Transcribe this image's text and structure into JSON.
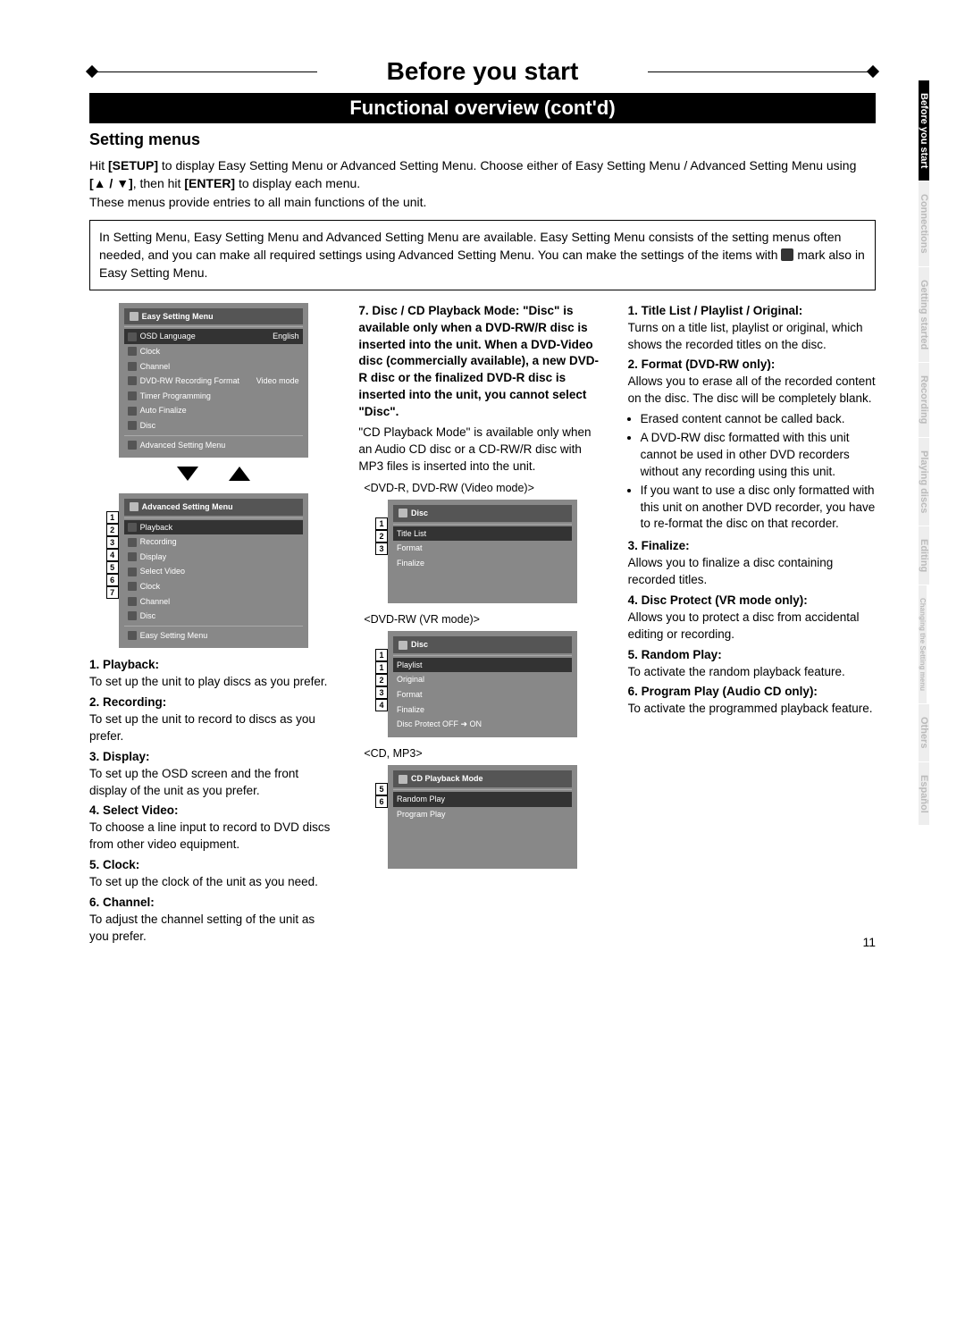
{
  "title": "Before you start",
  "subtitle": "Functional overview (cont'd)",
  "section_heading": "Setting menus",
  "intro": {
    "line1a": "Hit ",
    "button1": "[SETUP]",
    "line1b": " to display Easy Setting Menu or Advanced Setting Menu. Choose either of Easy Setting Menu / Advanced Setting Menu using ",
    "arrows": "[▲ / ▼]",
    "line1c": ", then hit ",
    "button2": "[ENTER]",
    "line1d": " to display each menu.",
    "line2": "These menus provide entries to all main functions of the unit."
  },
  "info_box": {
    "text_a": "In Setting Menu, Easy Setting Menu and Advanced Setting Menu are available. Easy Setting Menu consists of the setting menus often needed, and you can make all required settings using Advanced Setting Menu. You can make the settings of the items with ",
    "text_b": " mark also in Easy Setting Menu."
  },
  "easy_menu": {
    "header": "Easy Setting Menu",
    "rows": [
      {
        "label": "OSD Language",
        "value": "English",
        "hl": true
      },
      {
        "label": "Clock"
      },
      {
        "label": "Channel"
      },
      {
        "label": "DVD-RW Recording Format",
        "value": "Video mode"
      },
      {
        "label": "Timer Programming"
      },
      {
        "label": "Auto Finalize"
      },
      {
        "label": "Disc"
      }
    ],
    "footer": "Advanced Setting Menu"
  },
  "adv_menu": {
    "header": "Advanced Setting Menu",
    "rows": [
      {
        "num": "1",
        "label": "Playback",
        "hl": true
      },
      {
        "num": "2",
        "label": "Recording"
      },
      {
        "num": "3",
        "label": "Display"
      },
      {
        "num": "4",
        "label": "Select Video"
      },
      {
        "num": "5",
        "label": "Clock"
      },
      {
        "num": "6",
        "label": "Channel"
      },
      {
        "num": "7",
        "label": "Disc"
      }
    ],
    "footer": "Easy Setting Menu"
  },
  "adv_items": [
    {
      "h": "1. Playback:",
      "t": "To set up the unit to play discs as you prefer."
    },
    {
      "h": "2. Recording:",
      "t": "To set up the unit to record to discs as you prefer."
    },
    {
      "h": "3. Display:",
      "t": "To set up the OSD screen and the front display of the unit as you prefer."
    },
    {
      "h": "4. Select Video:",
      "t": "To choose a line input to record to DVD discs from other video equipment."
    },
    {
      "h": "5. Clock:",
      "t": "To set up the clock of the unit as you need."
    },
    {
      "h": "6. Channel:",
      "t": "To adjust the channel setting of the unit as you prefer."
    }
  ],
  "col2": {
    "heading": "7. Disc / CD Playback Mode: \"Disc\" is available only when a DVD-RW/R disc is inserted into the unit.  When a DVD-Video disc (commercially available), a new DVD-R disc or the finalized DVD-R disc is inserted into the unit, you cannot select \"Disc\".",
    "para": "\"CD Playback Mode\" is available only when an Audio CD disc or a CD-RW/R disc with MP3 files is inserted into the unit.",
    "mode1_label": "<DVD-R, DVD-RW (Video mode)>",
    "disc_menu1": {
      "header": "Disc",
      "rows": [
        {
          "num": "1",
          "label": "Title List",
          "hl": true
        },
        {
          "num": "2",
          "label": "Format"
        },
        {
          "num": "3",
          "label": "Finalize"
        }
      ]
    },
    "mode2_label": "<DVD-RW (VR mode)>",
    "disc_menu2": {
      "header": "Disc",
      "rows": [
        {
          "num": "1",
          "label": "Playlist",
          "hl": true
        },
        {
          "num": "1",
          "label": "Original"
        },
        {
          "num": "2",
          "label": "Format"
        },
        {
          "num": "3",
          "label": "Finalize"
        },
        {
          "num": "4",
          "label": "Disc Protect OFF ➜ ON"
        }
      ]
    },
    "mode3_label": "<CD, MP3>",
    "cd_menu": {
      "header": "CD Playback Mode",
      "rows": [
        {
          "num": "5",
          "label": "Random Play",
          "hl": true
        },
        {
          "num": "6",
          "label": "Program Play"
        }
      ]
    }
  },
  "col3": {
    "items": [
      {
        "h": "1. Title List / Playlist / Original:",
        "t": "Turns on a title list, playlist or original, which shows the recorded titles on the disc."
      },
      {
        "h": "2. Format (DVD-RW only):",
        "t": "Allows you to erase all of the recorded content on the disc. The disc will be completely blank."
      }
    ],
    "bullets": [
      "Erased content cannot be called back.",
      "A DVD-RW disc formatted with this unit cannot be used in other DVD recorders without any recording using this unit.",
      "If you want to use a disc only formatted with this unit on another DVD recorder, you have to re-format the disc on that recorder."
    ],
    "items2": [
      {
        "h": "3. Finalize:",
        "t": "Allows you to finalize a disc containing recorded titles."
      },
      {
        "h": "4. Disc Protect (VR mode only):",
        "t": "Allows you to protect a disc from accidental editing or recording."
      },
      {
        "h": "5. Random Play:",
        "t": "To activate the random playback feature."
      },
      {
        "h": "6. Program Play (Audio CD only):",
        "t": "To activate the programmed playback feature."
      }
    ]
  },
  "side_tabs": [
    {
      "label": "Before you start",
      "active": true
    },
    {
      "label": "Connections"
    },
    {
      "label": "Getting started"
    },
    {
      "label": "Recording"
    },
    {
      "label": "Playing discs"
    },
    {
      "label": "Editing"
    },
    {
      "label": "Changing the Setting menu"
    },
    {
      "label": "Others"
    },
    {
      "label": "Español"
    }
  ],
  "page_number": "11"
}
